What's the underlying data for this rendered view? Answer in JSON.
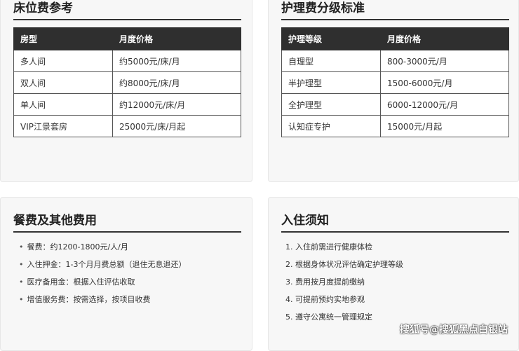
{
  "bed_fees": {
    "title": "床位费参考",
    "headers": [
      "房型",
      "月度价格"
    ],
    "rows": [
      [
        "多人间",
        "约5000元/床/月"
      ],
      [
        "双人间",
        "约8000元/床/月"
      ],
      [
        "单人间",
        "约12000元/床/月"
      ],
      [
        "VIP江景套房",
        "25000元/床/月起"
      ]
    ]
  },
  "care_fees": {
    "title": "护理费分级标准",
    "headers": [
      "护理等级",
      "月度价格"
    ],
    "rows": [
      [
        "自理型",
        "800-3000元/月"
      ],
      [
        "半护理型",
        "1500-6000元/月"
      ],
      [
        "全护理型",
        "6000-12000元/月"
      ],
      [
        "认知症专护",
        "15000元/月起"
      ]
    ]
  },
  "other_fees": {
    "title": "餐费及其他费用",
    "items": [
      "餐费：约1200-1800元/人/月",
      "入住押金：1-3个月月费总额（退住无息退还）",
      "医疗备用金：根据入住评估收取",
      "增值服务费：按需选择，按项目收费"
    ]
  },
  "notice": {
    "title": "入住须知",
    "items": [
      "1. 入住前需进行健康体检",
      "2. 根据身体状况评估确定护理等级",
      "3. 费用按月度提前缴纳",
      "4. 可提前预约实地参观",
      "5. 遵守公寓统一管理规定"
    ]
  },
  "watermark": "搜狐号@搜狐黑点白银站"
}
